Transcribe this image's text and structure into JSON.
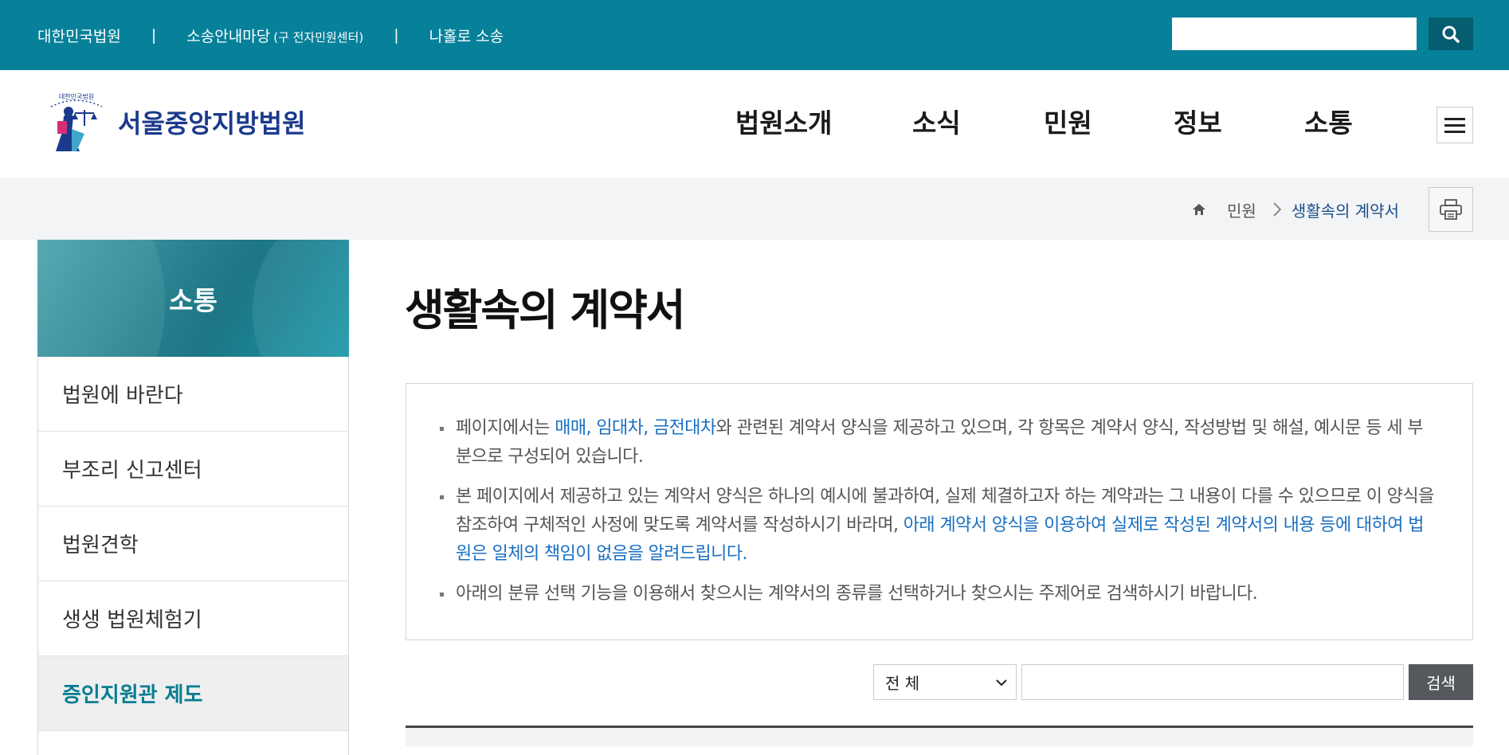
{
  "topbar": {
    "links": [
      "대한민국법원",
      "소송안내마당",
      "나홀로 소송"
    ],
    "link2_note": "(구 전자민원센터)",
    "separator": "|",
    "search_placeholder": ""
  },
  "header": {
    "logo_text": "서울중앙지방법원",
    "logo_small_text": "대한민국법원",
    "gnb": [
      "법원소개",
      "소식",
      "민원",
      "정보",
      "소통"
    ]
  },
  "breadcrumb": {
    "items": [
      "민원",
      "생활속의 계약서"
    ]
  },
  "sidebar": {
    "title": "소통",
    "items": [
      {
        "label": "법원에 바란다"
      },
      {
        "label": "부조리 신고센터"
      },
      {
        "label": "법원견학"
      },
      {
        "label": "생생 법원체험기"
      },
      {
        "label": "증인지원관 제도",
        "active": true
      }
    ]
  },
  "content": {
    "title": "생활속의 계약서",
    "info": {
      "item1_pre": "페이지에서는 ",
      "item1_links": [
        "매매",
        "임대차",
        "금전대차"
      ],
      "item1_comma": ", ",
      "item1_post": "와 관련된 계약서 양식을 제공하고 있으며, 각 항목은 계약서 양식, 작성방법 및 해설, 예시문 등 세 부분으로 구성되어 있습니다.",
      "item2_pre": "본 페이지에서 제공하고 있는 계약서 양식은 하나의 예시에 불과하여, 실제 체결하고자 하는 계약과는 그 내용이 다를 수 있으므로 이 양식을 참조하여 구체적인 사정에 맞도록 계약서를 작성하시기 바라며, ",
      "item2_blue": "아래 계약서 양식을 이용하여 실제로 작성된 계약서의 내용 등에 대하여 법원은 일체의 책임이 없음을 알려드립니다.",
      "item3": "아래의 분류 선택 기능을 이용해서 찾으시는 계약서의 종류를 선택하거나 찾으시는 주제어로 검색하시기 바랍니다."
    },
    "search": {
      "select_value": "전 체",
      "input_value": "",
      "button_label": "검색"
    }
  },
  "colors": {
    "topbar_bg": "#07819a",
    "link_blue": "#1a6fc2",
    "active_teal": "#077d92"
  }
}
